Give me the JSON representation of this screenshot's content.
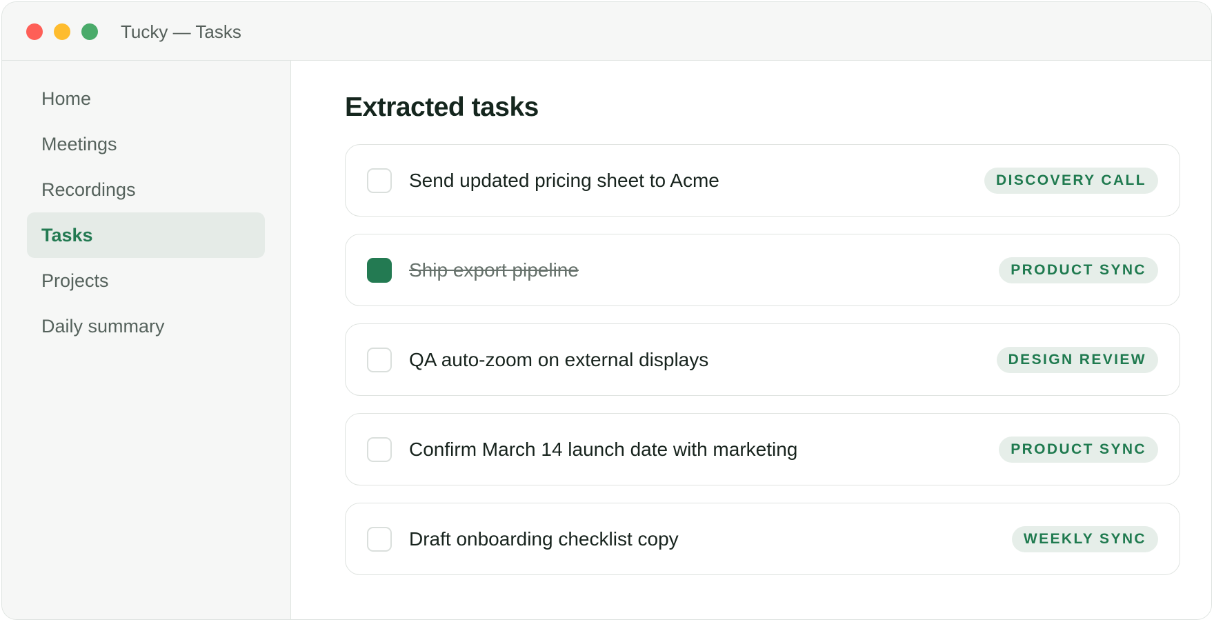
{
  "window": {
    "title": "Tucky — Tasks",
    "controls": {
      "close_color": "#fe5f57",
      "minimize_color": "#febc2e",
      "zoom_color": "#4aab6a"
    }
  },
  "sidebar": {
    "items": [
      {
        "label": "Home",
        "active": false
      },
      {
        "label": "Meetings",
        "active": false
      },
      {
        "label": "Recordings",
        "active": false
      },
      {
        "label": "Tasks",
        "active": true
      },
      {
        "label": "Projects",
        "active": false
      },
      {
        "label": "Daily summary",
        "active": false
      }
    ]
  },
  "main": {
    "title": "Extracted tasks",
    "tasks": [
      {
        "text": "Send updated pricing sheet to Acme",
        "tag": "DISCOVERY CALL",
        "done": false
      },
      {
        "text": "Ship export pipeline",
        "tag": "PRODUCT SYNC",
        "done": true
      },
      {
        "text": "QA auto-zoom on external displays",
        "tag": "DESIGN REVIEW",
        "done": false
      },
      {
        "text": "Confirm March 14 launch date with marketing",
        "tag": "PRODUCT SYNC",
        "done": false
      },
      {
        "text": "Draft onboarding checklist copy",
        "tag": "WEEKLY SYNC",
        "done": false
      }
    ]
  },
  "colors": {
    "accent": "#237a52",
    "tag_background": "#e6eee9",
    "sidebar_background": "#f6f7f6",
    "active_item_background": "#e5ebe7"
  }
}
